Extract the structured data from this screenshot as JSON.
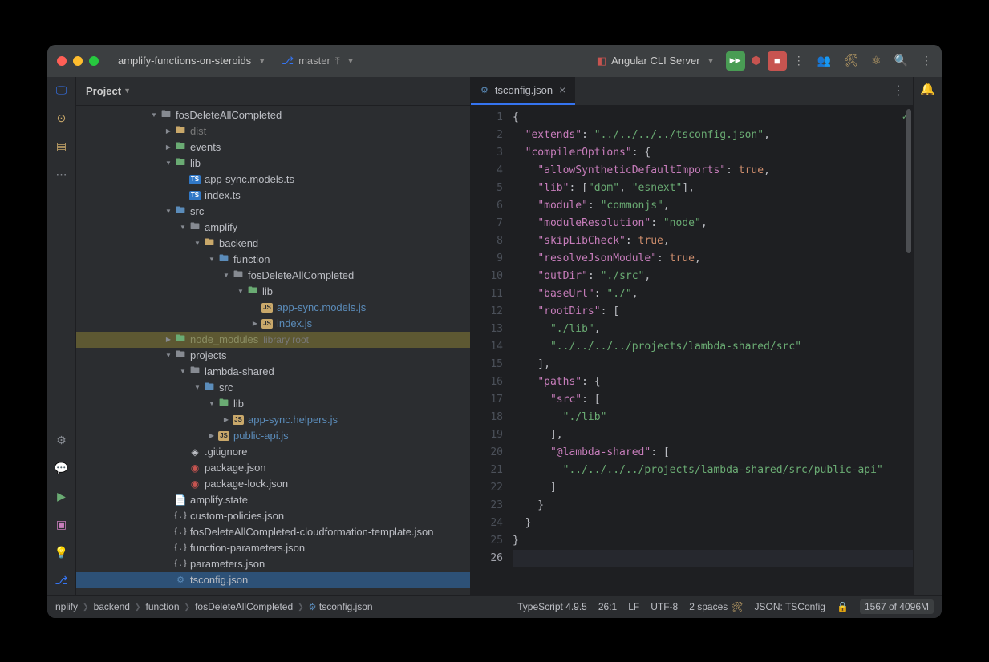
{
  "titlebar": {
    "project": "amplify-functions-on-steroids",
    "branch": "master",
    "runConfig": "Angular CLI Server"
  },
  "gutter_left": [
    "▢",
    "○",
    "▤",
    "⋯"
  ],
  "gutter_left_bottom": [
    "⚙",
    "💬",
    "▶",
    "▣",
    "💡",
    "⎇"
  ],
  "sidebar": {
    "header": "Project"
  },
  "tree": [
    {
      "d": 5,
      "a": "v",
      "ic": "fold",
      "t": "fosDeleteAllCompleted"
    },
    {
      "d": 6,
      "a": ">",
      "ic": "fold-y",
      "t": "dist",
      "cls": "dim"
    },
    {
      "d": 6,
      "a": ">",
      "ic": "fold-g",
      "t": "events"
    },
    {
      "d": 6,
      "a": "v",
      "ic": "fold-g",
      "t": "lib"
    },
    {
      "d": 7,
      "a": "",
      "ic": "ts",
      "t": "app-sync.models.ts"
    },
    {
      "d": 7,
      "a": "",
      "ic": "ts",
      "t": "index.ts"
    },
    {
      "d": 6,
      "a": "v",
      "ic": "fold-b",
      "t": "src"
    },
    {
      "d": 7,
      "a": "v",
      "ic": "fold",
      "t": "amplify"
    },
    {
      "d": 8,
      "a": "v",
      "ic": "fold-y",
      "t": "backend"
    },
    {
      "d": 9,
      "a": "v",
      "ic": "fold-b",
      "t": "function"
    },
    {
      "d": 10,
      "a": "v",
      "ic": "fold",
      "t": "fosDeleteAllCompleted"
    },
    {
      "d": 11,
      "a": "v",
      "ic": "fold-g",
      "t": "lib"
    },
    {
      "d": 12,
      "a": "",
      "ic": "js",
      "t": "app-sync.models.js",
      "cls": "blue"
    },
    {
      "d": 12,
      "a": ">",
      "ic": "js",
      "t": "index.js",
      "cls": "blue"
    },
    {
      "d": 6,
      "a": ">",
      "ic": "fold-g",
      "t": "node_modules",
      "hint": "library root",
      "row": "nodemod"
    },
    {
      "d": 6,
      "a": "v",
      "ic": "fold",
      "t": "projects"
    },
    {
      "d": 7,
      "a": "v",
      "ic": "fold",
      "t": "lambda-shared"
    },
    {
      "d": 8,
      "a": "v",
      "ic": "fold-b",
      "t": "src"
    },
    {
      "d": 9,
      "a": "v",
      "ic": "fold-g",
      "t": "lib"
    },
    {
      "d": 10,
      "a": ">",
      "ic": "js",
      "t": "app-sync.helpers.js",
      "cls": "blue"
    },
    {
      "d": 9,
      "a": ">",
      "ic": "js",
      "t": "public-api.js",
      "cls": "blue"
    },
    {
      "d": 7,
      "a": "",
      "ic": "git",
      "t": ".gitignore"
    },
    {
      "d": 7,
      "a": "",
      "ic": "red",
      "t": "package.json"
    },
    {
      "d": 7,
      "a": "",
      "ic": "red",
      "t": "package-lock.json"
    },
    {
      "d": 6,
      "a": "",
      "ic": "file",
      "t": "amplify.state"
    },
    {
      "d": 6,
      "a": "",
      "ic": "json",
      "t": "custom-policies.json"
    },
    {
      "d": 6,
      "a": "",
      "ic": "json",
      "t": "fosDeleteAllCompleted-cloudformation-template.json"
    },
    {
      "d": 6,
      "a": "",
      "ic": "json",
      "t": "function-parameters.json"
    },
    {
      "d": 6,
      "a": "",
      "ic": "json",
      "t": "parameters.json"
    },
    {
      "d": 6,
      "a": "",
      "ic": "gear",
      "t": "tsconfig.json",
      "row": "sel"
    }
  ],
  "tab": {
    "icon": "⚙",
    "name": "tsconfig.json"
  },
  "code": {
    "lines": 26,
    "content": {
      "extends": "../../../../tsconfig.json",
      "compilerOptions": {
        "allowSyntheticDefaultImports": true,
        "lib": [
          "dom",
          "esnext"
        ],
        "module": "commonjs",
        "moduleResolution": "node",
        "skipLibCheck": true,
        "resolveJsonModule": true,
        "outDir": "./src",
        "baseUrl": "./",
        "rootDirs": [
          "./lib",
          "../../../../projects/lambda-shared/src"
        ],
        "paths": {
          "src": [
            "./lib"
          ],
          "@lambda-shared": [
            "../../../../projects/lambda-shared/src/public-api"
          ]
        }
      }
    }
  },
  "breadcrumbs": [
    "nplify",
    "backend",
    "function",
    "fosDeleteAllCompleted",
    "tsconfig.json"
  ],
  "status": {
    "ts": "TypeScript 4.9.5",
    "pos": "26:1",
    "eol": "LF",
    "enc": "UTF-8",
    "indent": "2 spaces",
    "schema": "JSON: TSConfig",
    "mem": "1567 of 4096M"
  }
}
